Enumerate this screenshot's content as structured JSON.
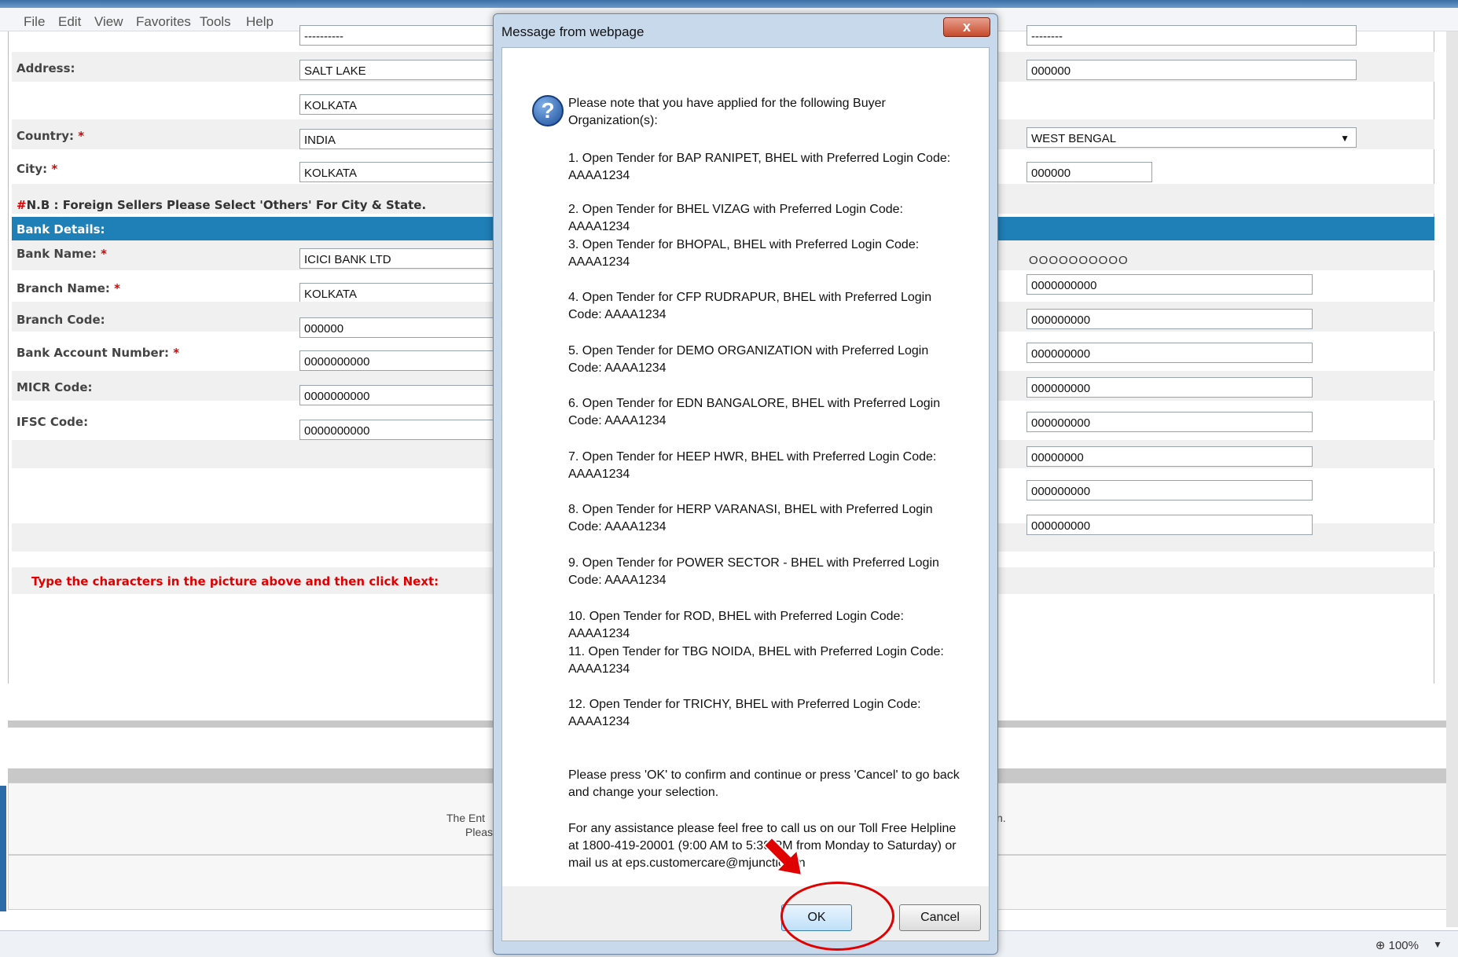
{
  "menu": [
    "File",
    "Edit",
    "View",
    "Favorites",
    "Tools",
    "Help"
  ],
  "form": {
    "address_label": "Address:",
    "address_line1": "SALT LAKE",
    "address_line2": "KOLKATA",
    "country_label": "Country:",
    "country_value": "INDIA",
    "city_label": "City:",
    "city_value": "KOLKATA",
    "required_mark": "*",
    "right_top_value": "--------",
    "right_address_value": "000000",
    "state_value": "WEST BENGAL",
    "right_city_value": "000000",
    "left_top_value": "----------",
    "nb_hash": "#",
    "nb_note": "N.B : Foreign Sellers Please Select 'Others' For City & State.",
    "bank_header": "Bank Details:",
    "bank_name_label": "Bank Name:",
    "bank_name_value": "ICICI BANK LTD",
    "branch_name_label": "Branch Name:",
    "branch_name_value": "KOLKATA",
    "branch_code_label": "Branch Code:",
    "branch_code_value": "000000",
    "account_label": "Bank Account Number:",
    "account_value": "0000000000",
    "micr_label": "MICR Code:",
    "micr_value": "0000000000",
    "ifsc_label": "IFSC Code:",
    "ifsc_value": "0000000000",
    "right_plain_value": "OOOOOOOOOO",
    "right_values": [
      "0000000000",
      "000000000",
      "000000000",
      "000000000",
      "000000000",
      "00000000",
      "000000000",
      "000000000"
    ],
    "captcha_note": "Type the characters in the picture above and then click Next:"
  },
  "footer": {
    "text1": "The Ent",
    "text2": "Pleas",
    "text3": "n."
  },
  "status": {
    "zoom": "100%"
  },
  "dialog": {
    "title": "Message from webpage",
    "close": "x",
    "intro": "Please note that you have applied for the following Buyer Organization(s):",
    "items": [
      "1. Open Tender for BAP RANIPET, BHEL with Preferred Login Code: AAAA1234",
      "2. Open Tender for BHEL VIZAG with Preferred Login Code: AAAA1234",
      "3. Open Tender for BHOPAL, BHEL with Preferred Login Code: AAAA1234",
      "4. Open Tender for CFP RUDRAPUR, BHEL with Preferred Login Code: AAAA1234",
      "5. Open Tender for DEMO ORGANIZATION with Preferred Login Code: AAAA1234",
      "6. Open Tender for EDN BANGALORE, BHEL with Preferred Login Code: AAAA1234",
      "7. Open Tender for HEEP HWR, BHEL with Preferred Login Code: AAAA1234",
      "8. Open Tender for HERP VARANASI, BHEL with Preferred Login Code: AAAA1234",
      "9. Open Tender for POWER SECTOR - BHEL with Preferred Login Code: AAAA1234",
      "10. Open Tender for ROD, BHEL with Preferred Login Code: AAAA1234",
      "11. Open Tender for TBG NOIDA, BHEL with Preferred Login Code: AAAA1234",
      "12. Open Tender for TRICHY, BHEL with Preferred Login Code: AAAA1234"
    ],
    "confirm_text": "Please press 'OK' to confirm and continue or press 'Cancel' to go back and change your selection.",
    "help_text": "For any assistance please feel free to call us on our Toll Free Helpline at 1800-419-20001 (9:00 AM to 5:30 PM from Monday to Saturday) or mail us at eps.customercare@mjunction.in",
    "ok_label": "OK",
    "cancel_label": "Cancel"
  },
  "colors": {
    "bank_header": "#1f7fb7",
    "required": "#e00000",
    "highlight": "#e00000"
  }
}
